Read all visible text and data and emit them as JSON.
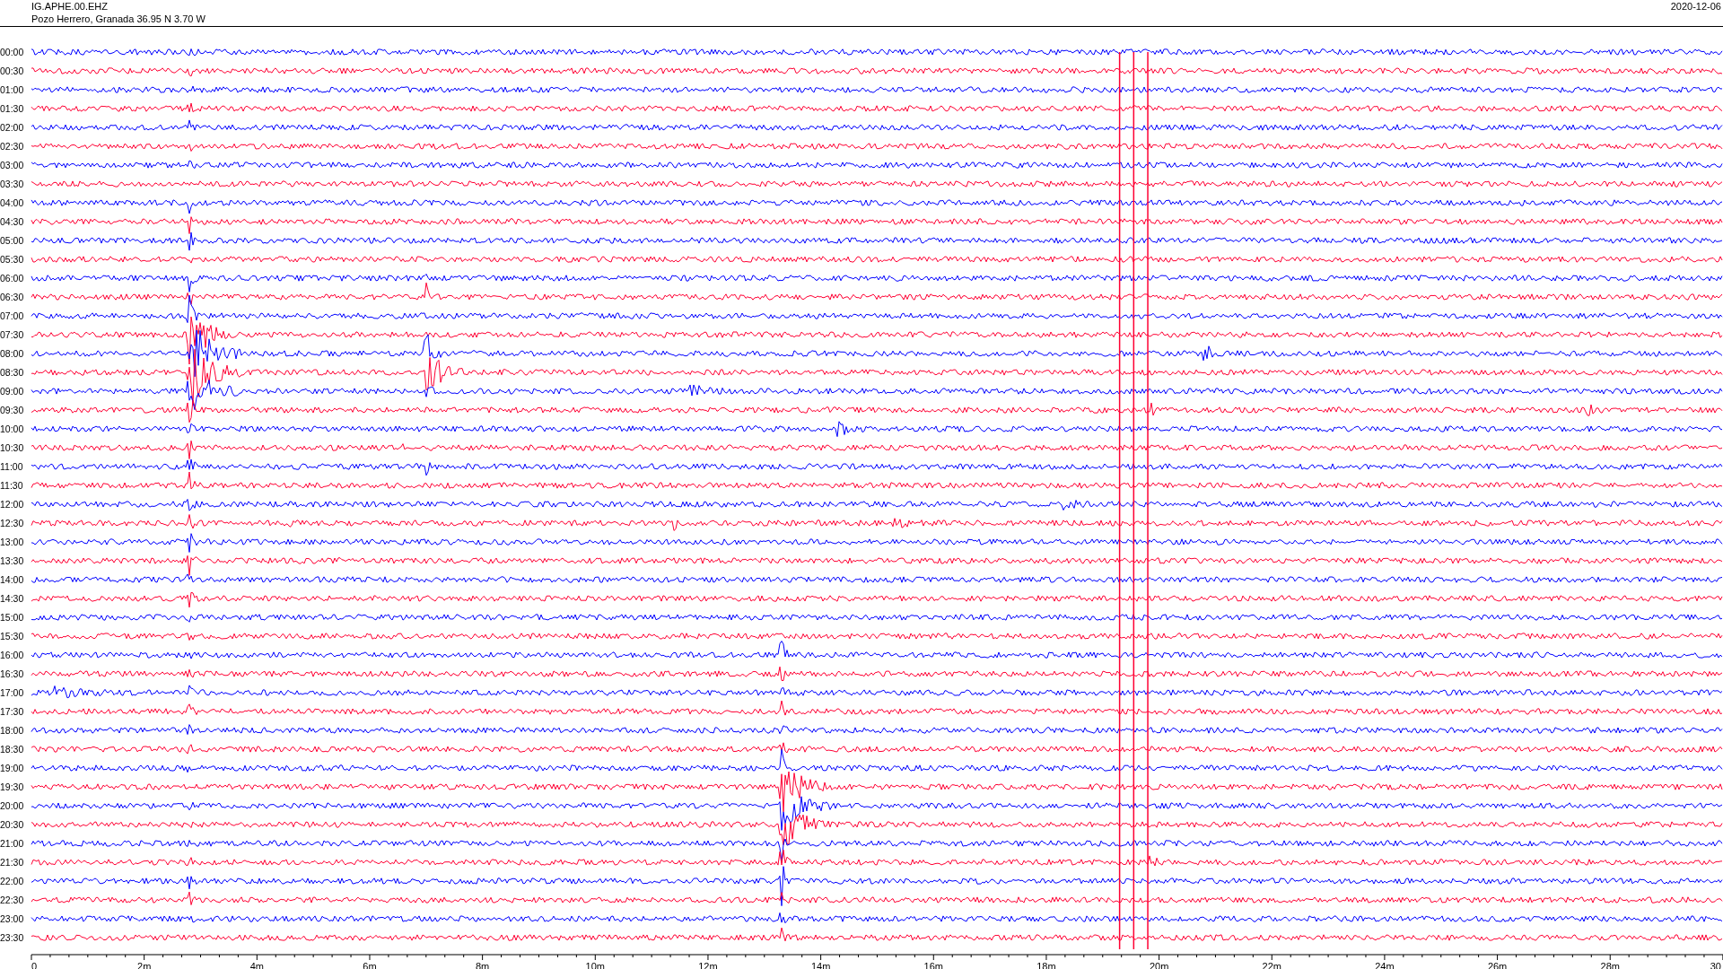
{
  "header": {
    "station": "IG.APHE.00.EHZ",
    "location": "Pozo Herrero, Granada  36.95 N 3.70 W",
    "date": "2020-12-06"
  },
  "rows": [
    {
      "time": "00:00"
    },
    {
      "time": "00:30"
    },
    {
      "time": "01:00"
    },
    {
      "time": "01:30"
    },
    {
      "time": "02:00"
    },
    {
      "time": "02:30"
    },
    {
      "time": "03:00"
    },
    {
      "time": "03:30"
    },
    {
      "time": "04:00"
    },
    {
      "time": "04:30"
    },
    {
      "time": "05:00"
    },
    {
      "time": "05:30"
    },
    {
      "time": "06:00"
    },
    {
      "time": "06:30"
    },
    {
      "time": "07:00"
    },
    {
      "time": "07:30"
    },
    {
      "time": "08:00"
    },
    {
      "time": "08:30"
    },
    {
      "time": "09:00"
    },
    {
      "time": "09:30"
    },
    {
      "time": "10:00"
    },
    {
      "time": "10:30"
    },
    {
      "time": "11:00"
    },
    {
      "time": "11:30"
    },
    {
      "time": "12:00"
    },
    {
      "time": "12:30"
    },
    {
      "time": "13:00"
    },
    {
      "time": "13:30"
    },
    {
      "time": "14:00"
    },
    {
      "time": "14:30"
    },
    {
      "time": "15:00"
    },
    {
      "time": "15:30"
    },
    {
      "time": "16:00"
    },
    {
      "time": "16:30"
    },
    {
      "time": "17:00"
    },
    {
      "time": "17:30"
    },
    {
      "time": "18:00"
    },
    {
      "time": "18:30"
    },
    {
      "time": "19:00"
    },
    {
      "time": "19:30"
    },
    {
      "time": "20:00"
    },
    {
      "time": "20:30"
    },
    {
      "time": "21:00"
    },
    {
      "time": "21:30"
    },
    {
      "time": "22:00"
    },
    {
      "time": "22:30"
    },
    {
      "time": "23:00"
    },
    {
      "time": "23:30"
    }
  ],
  "x_axis": {
    "ticks": [
      "0",
      "2m",
      "4m",
      "6m",
      "8m",
      "10m",
      "12m",
      "14m",
      "16m",
      "18m",
      "20m",
      "22m",
      "24m",
      "26m",
      "28m",
      "30"
    ]
  }
}
